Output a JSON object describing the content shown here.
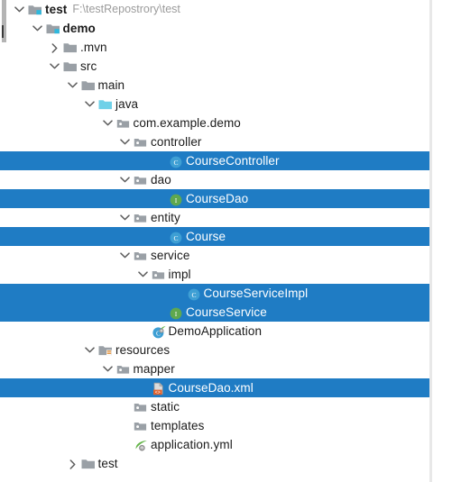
{
  "panel": {
    "name": "project-tool-window",
    "background_color": "#ffffff",
    "selection_color": "#1f7cc4",
    "selection_text_color": "#ffffff",
    "divider_color": "#e8e8e8",
    "scrollbar_color": "#b4b4b4"
  },
  "tree": {
    "rows": [
      {
        "label": "test",
        "sublabel": "F:\\testRepostrory\\test",
        "depth": 0,
        "icon": "module-folder-icon",
        "twisty": "chevron-down-icon",
        "bold": true,
        "selected": false
      },
      {
        "label": "demo",
        "sublabel": "",
        "depth": 1,
        "icon": "module-folder-icon",
        "twisty": "chevron-down-icon",
        "bold": true,
        "selected": false
      },
      {
        "label": ".mvn",
        "sublabel": "",
        "depth": 2,
        "icon": "folder-icon",
        "twisty": "chevron-right-icon",
        "bold": false,
        "selected": false
      },
      {
        "label": "src",
        "sublabel": "",
        "depth": 2,
        "icon": "folder-icon",
        "twisty": "chevron-down-icon",
        "bold": false,
        "selected": false
      },
      {
        "label": "main",
        "sublabel": "",
        "depth": 3,
        "icon": "folder-icon",
        "twisty": "chevron-down-icon",
        "bold": false,
        "selected": false
      },
      {
        "label": "java",
        "sublabel": "",
        "depth": 4,
        "icon": "source-root-folder-icon",
        "twisty": "chevron-down-icon",
        "bold": false,
        "selected": false
      },
      {
        "label": "com.example.demo",
        "sublabel": "",
        "depth": 5,
        "icon": "package-icon",
        "twisty": "chevron-down-icon",
        "bold": false,
        "selected": false
      },
      {
        "label": "controller",
        "sublabel": "",
        "depth": 6,
        "icon": "package-icon",
        "twisty": "chevron-down-icon",
        "bold": false,
        "selected": false
      },
      {
        "label": "CourseController",
        "sublabel": "",
        "depth": 8,
        "icon": "java-class-icon",
        "twisty": "none",
        "bold": false,
        "selected": true
      },
      {
        "label": "dao",
        "sublabel": "",
        "depth": 6,
        "icon": "package-icon",
        "twisty": "chevron-down-icon",
        "bold": false,
        "selected": false
      },
      {
        "label": "CourseDao",
        "sublabel": "",
        "depth": 8,
        "icon": "java-interface-icon",
        "twisty": "none",
        "bold": false,
        "selected": true
      },
      {
        "label": "entity",
        "sublabel": "",
        "depth": 6,
        "icon": "package-icon",
        "twisty": "chevron-down-icon",
        "bold": false,
        "selected": false
      },
      {
        "label": "Course",
        "sublabel": "",
        "depth": 8,
        "icon": "java-class-icon",
        "twisty": "none",
        "bold": false,
        "selected": true
      },
      {
        "label": "service",
        "sublabel": "",
        "depth": 6,
        "icon": "package-icon",
        "twisty": "chevron-down-icon",
        "bold": false,
        "selected": false
      },
      {
        "label": "impl",
        "sublabel": "",
        "depth": 7,
        "icon": "package-icon",
        "twisty": "chevron-down-icon",
        "bold": false,
        "selected": false
      },
      {
        "label": "CourseServiceImpl",
        "sublabel": "",
        "depth": 9,
        "icon": "java-class-icon",
        "twisty": "none",
        "bold": false,
        "selected": true
      },
      {
        "label": "CourseService",
        "sublabel": "",
        "depth": 8,
        "icon": "java-interface-icon",
        "twisty": "none",
        "bold": false,
        "selected": true
      },
      {
        "label": "DemoApplication",
        "sublabel": "",
        "depth": 7,
        "icon": "spring-boot-class-icon",
        "twisty": "none",
        "bold": false,
        "selected": false
      },
      {
        "label": "resources",
        "sublabel": "",
        "depth": 4,
        "icon": "resource-root-folder-icon",
        "twisty": "chevron-down-icon",
        "bold": false,
        "selected": false
      },
      {
        "label": "mapper",
        "sublabel": "",
        "depth": 5,
        "icon": "package-icon",
        "twisty": "chevron-down-icon",
        "bold": false,
        "selected": false
      },
      {
        "label": "CourseDao.xml",
        "sublabel": "",
        "depth": 7,
        "icon": "xml-file-icon",
        "twisty": "none",
        "bold": false,
        "selected": true
      },
      {
        "label": "static",
        "sublabel": "",
        "depth": 6,
        "icon": "package-icon",
        "twisty": "none",
        "bold": false,
        "selected": false
      },
      {
        "label": "templates",
        "sublabel": "",
        "depth": 6,
        "icon": "package-icon",
        "twisty": "none",
        "bold": false,
        "selected": false
      },
      {
        "label": "application.yml",
        "sublabel": "",
        "depth": 6,
        "icon": "spring-yaml-icon",
        "twisty": "none",
        "bold": false,
        "selected": false
      },
      {
        "label": "test",
        "sublabel": "",
        "depth": 3,
        "icon": "folder-icon",
        "twisty": "chevron-right-icon",
        "bold": false,
        "selected": false
      }
    ]
  }
}
